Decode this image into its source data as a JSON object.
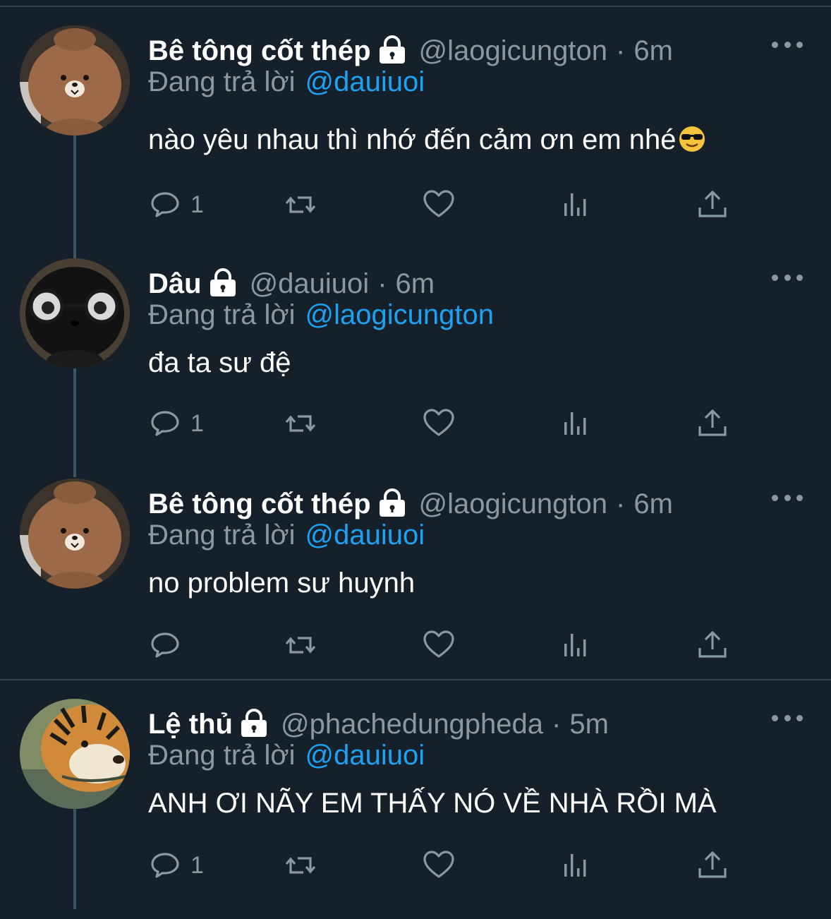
{
  "icons": {
    "lock": "lock-icon",
    "reply": "reply-icon",
    "retweet": "retweet-icon",
    "like": "heart-icon",
    "analytics": "analytics-icon",
    "share": "share-icon",
    "more": "more-icon",
    "emoji": "sunglasses-emoji"
  },
  "colors": {
    "background": "#15202b",
    "secondary_text": "#8899a6",
    "mention": "#1da1f2",
    "thread_line": "#3d5466"
  },
  "reply_prefix": "Đang trả lời",
  "tweets": [
    {
      "name": "Bê tông cốt thép",
      "handle": "@laogicungton",
      "separator": "·",
      "time": "6m",
      "reply_to": "@dauiuoi",
      "text": "nào yêu nhau thì nhớ đến cảm ơn em nhé",
      "reply_count": "1",
      "avatar": "brown-bear"
    },
    {
      "name": "Dâu",
      "handle": "@dauiuoi",
      "separator": "·",
      "time": "6m",
      "reply_to": "@laogicungton",
      "text": "đa ta sư đệ",
      "reply_count": "1",
      "avatar": "black-plush-glasses"
    },
    {
      "name": "Bê tông cốt thép",
      "handle": "@laogicungton",
      "separator": "·",
      "time": "6m",
      "reply_to": "@dauiuoi",
      "text": "no problem sư huynh",
      "reply_count": "",
      "avatar": "brown-bear"
    },
    {
      "name": "Lệ thủ",
      "handle": "@phachedungpheda",
      "separator": "·",
      "time": "5m",
      "reply_to": "@dauiuoi",
      "text": "ANH ƠI NÃY EM THẤY NÓ VỀ NHÀ RỒI MÀ",
      "reply_count": "1",
      "avatar": "tiger"
    }
  ]
}
